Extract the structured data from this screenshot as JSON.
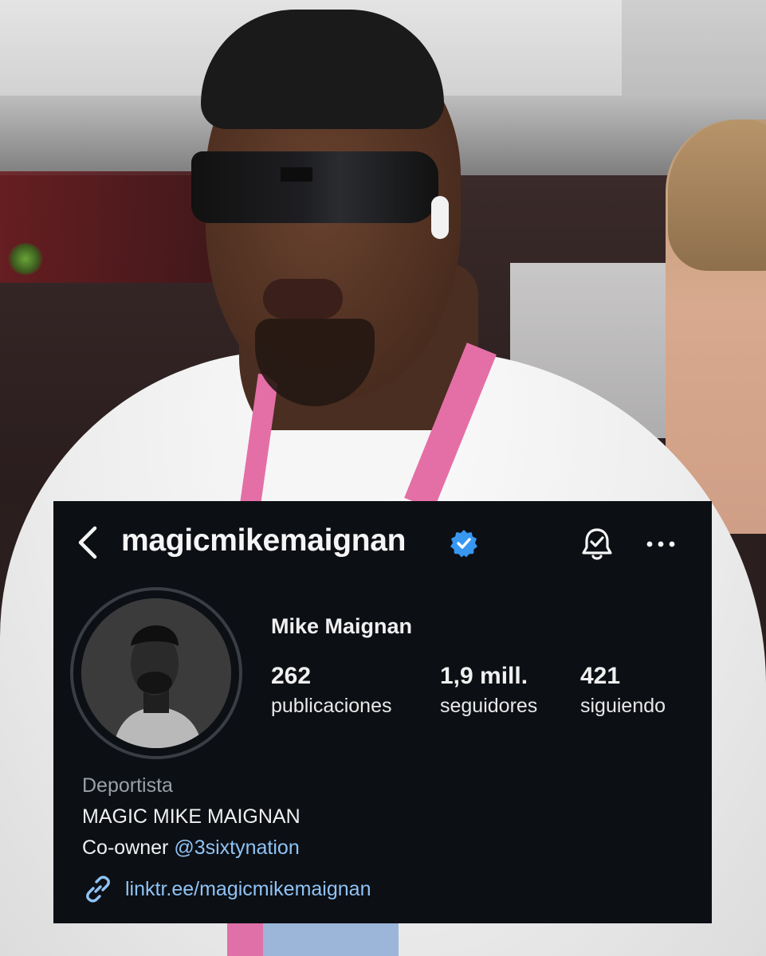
{
  "header": {
    "username": "magicmikemaignan",
    "back_icon": "chevron-left-icon",
    "verified_icon": "verified-badge-icon",
    "bell_icon": "bell-icon",
    "more_icon": "more-horizontal-icon"
  },
  "profile": {
    "display_name": "Mike Maignan",
    "stats": [
      {
        "value": "262",
        "label": "publicaciones"
      },
      {
        "value": "1,9 mill.",
        "label": "seguidores"
      },
      {
        "value": "421",
        "label": "siguiendo"
      }
    ],
    "category": "Deportista",
    "bio_line1": "MAGIC MIKE MAIGNAN",
    "bio_line2_prefix": "Co-owner ",
    "bio_mention": "@3sixtynation",
    "link": "linktr.ee/magicmikemaignan",
    "link_icon": "link-icon"
  },
  "colors": {
    "card_background": "#0c0f14",
    "link_blue": "#8fc3f5",
    "verified_blue": "#3897f0"
  }
}
